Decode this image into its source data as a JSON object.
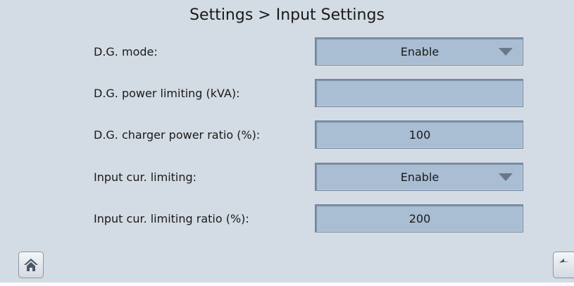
{
  "header": {
    "title": "Settings > Input Settings"
  },
  "settings": [
    {
      "label": "D.G. mode:",
      "value": "Enable",
      "type": "dropdown"
    },
    {
      "label": "D.G. power limiting (kVA):",
      "value": "",
      "type": "input"
    },
    {
      "label": "D.G. charger power ratio (%):",
      "value": "100",
      "type": "input"
    },
    {
      "label": "Input cur. limiting:",
      "value": "Enable",
      "type": "dropdown"
    },
    {
      "label": "Input cur. limiting ratio (%):",
      "value": "200",
      "type": "input"
    }
  ],
  "nav": {
    "home_icon": "home-icon",
    "back_icon": "back-arrow-icon"
  },
  "colors": {
    "screen_background": "#d3dbe4",
    "field_background": "#a9bdd3",
    "caret": "#6b7787"
  }
}
